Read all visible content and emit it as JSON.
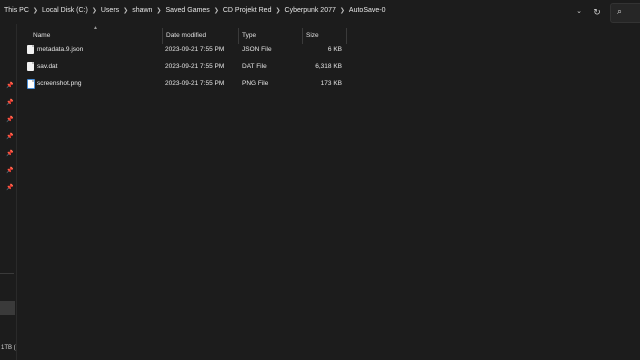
{
  "breadcrumb": [
    "This PC",
    "Local Disk (C:)",
    "Users",
    "shawn",
    "Saved Games",
    "CD Projekt Red",
    "Cyberpunk 2077",
    "AutoSave-0"
  ],
  "columns": {
    "name": "Name",
    "date": "Date modified",
    "type": "Type",
    "size": "Size"
  },
  "files": [
    {
      "name": "metadata.9.json",
      "date": "2023-09-21 7:55 PM",
      "type": "JSON File",
      "size": "6 KB",
      "icon": "json-file-icon"
    },
    {
      "name": "sav.dat",
      "date": "2023-09-21 7:55 PM",
      "type": "DAT File",
      "size": "6,318 KB",
      "icon": "dat-file-icon"
    },
    {
      "name": "screenshot.png",
      "date": "2023-09-21 7:55 PM",
      "type": "PNG File",
      "size": "173 KB",
      "icon": "png-file-icon"
    }
  ],
  "nav": {
    "drive_label": "1TB ("
  },
  "icons": {
    "pin": "pin-icon",
    "refresh": "refresh-icon",
    "dropdown": "chevron-down-icon",
    "search": "search-icon"
  },
  "colors": {
    "background": "#1c1c1c",
    "text": "#e6e6e6",
    "divider": "#3a3a3a"
  }
}
